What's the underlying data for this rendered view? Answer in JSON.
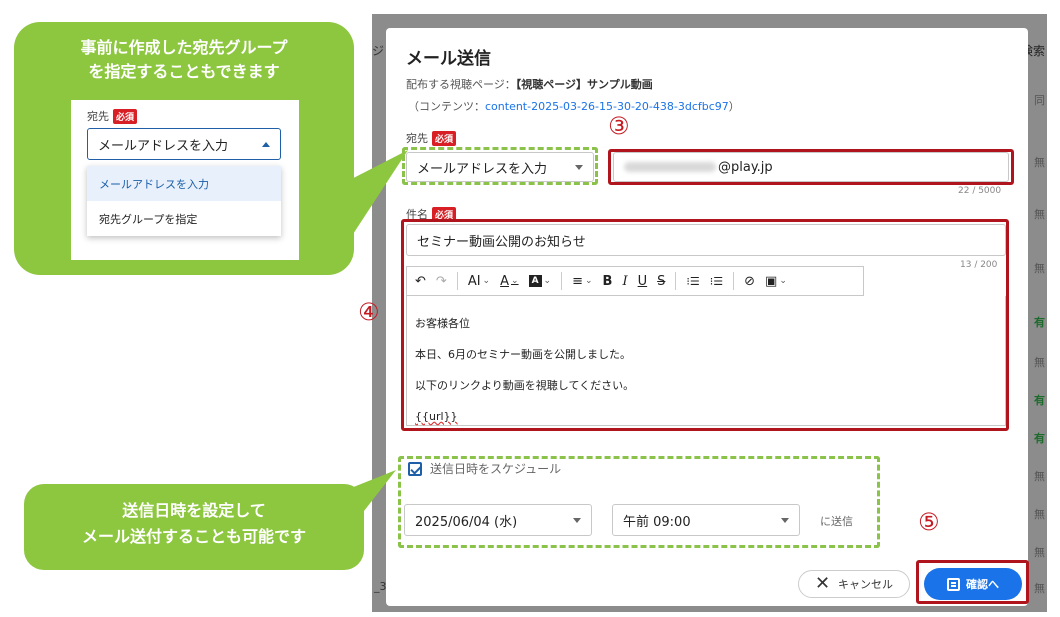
{
  "background": {
    "column_header": "ジ",
    "right_header": "検索",
    "right_cells": [
      "同",
      "無",
      "無",
      "無",
      "有",
      "無",
      "有",
      "有",
      "無",
      "無",
      "無",
      "無"
    ],
    "bottom_left": "_3"
  },
  "modal": {
    "title": "メール送信",
    "dist_prefix": "配布する視聴ページ：",
    "dist_value": "【視聴ページ】サンプル動画",
    "content_prefix": "（コンテンツ：",
    "content_link": "content-2025-03-26-15-30-20-438-3dcfbc97",
    "content_suffix": "）",
    "to_label": "宛先",
    "required": "必須",
    "to_select": "メールアドレスを入力",
    "email_domain": "@play.jp",
    "email_counter": "22 / 5000",
    "subject_label": "件名",
    "subject_value": "セミナー動画公開のお知らせ",
    "subject_counter": "13 / 200",
    "toolbar": {
      "undo": "↶",
      "redo": "↷",
      "font_size": "AI",
      "font_color": "A",
      "highlight": "A",
      "align": "≡",
      "bold": "B",
      "italic": "I",
      "underline": "U",
      "strike": "S",
      "bullet_list": "⁝☰",
      "ordered_list": "⁝☰",
      "link": "⊘",
      "image": "▣"
    },
    "body_lines": [
      "お客様各位",
      "本日、6月のセミナー動画を公開しました。",
      "以下のリンクより動画を視聴してください。",
      "{{url}}"
    ],
    "schedule_label": "送信日時をスケジュール",
    "date_value": "2025/06/04 (水)",
    "time_value": "午前 09:00",
    "send_suffix": "に送信",
    "cancel_label": "キャンセル",
    "confirm_label": "確認へ"
  },
  "annotations": {
    "num3": "③",
    "num4": "④",
    "num5": "⑤",
    "bubble1_line1": "事前に作成した宛先グループ",
    "bubble1_line2": "を指定することもできます",
    "bubble2_line1": "送信日時を設定して",
    "bubble2_line2": "メール送付することも可能です",
    "callout": {
      "label": "宛先",
      "required": "必須",
      "select": "メールアドレスを入力",
      "items": [
        "メールアドレスを入力",
        "宛先グループを指定"
      ]
    }
  },
  "colors": {
    "annotation_red": "#b0151d",
    "annotation_green": "#8dc63f",
    "primary": "#1a73e8",
    "required_badge": "#d81f26"
  }
}
